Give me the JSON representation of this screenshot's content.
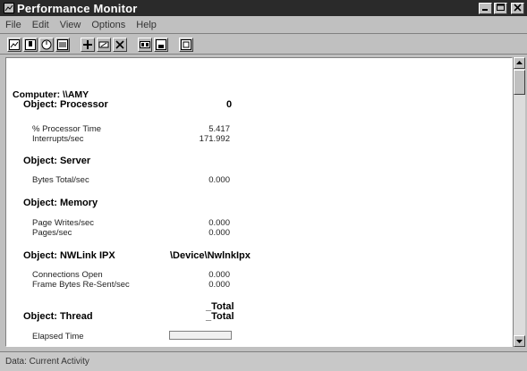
{
  "window": {
    "title": "Performance Monitor"
  },
  "menu": [
    "File",
    "Edit",
    "View",
    "Options",
    "Help"
  ],
  "toolbar": [
    "chart-view-icon",
    "alert-view-icon",
    "log-view-icon",
    "report-view-icon",
    "add-counter-icon",
    "edit-counter-icon",
    "delete-counter-icon",
    "update-now-icon",
    "bookmark-icon",
    "options-icon"
  ],
  "report": {
    "computer": "Computer: \\\\AMY",
    "processor": {
      "object": "Object: Processor",
      "instance": "0",
      "counters": [
        {
          "name": "% Processor Time",
          "value": "5.417"
        },
        {
          "name": "Interrupts/sec",
          "value": "171.992"
        }
      ]
    },
    "server": {
      "object": "Object: Server",
      "counters": [
        {
          "name": "Bytes Total/sec",
          "value": "0.000"
        }
      ]
    },
    "memory": {
      "object": "Object: Memory",
      "counters": [
        {
          "name": "Page Writes/sec",
          "value": "0.000"
        },
        {
          "name": "Pages/sec",
          "value": "0.000"
        }
      ]
    },
    "ipx": {
      "object": "Object: NWLink IPX",
      "instance": "\\Device\\NwlnkIpx",
      "counters": [
        {
          "name": "Connections Open",
          "value": "0.000"
        },
        {
          "name": "Frame Bytes Re-Sent/sec",
          "value": "0.000"
        }
      ]
    },
    "thread": {
      "object": "Object: Thread",
      "instance_top": "_Total",
      "instance": "_Total",
      "counters": [
        {
          "name": "Elapsed Time",
          "value": ""
        }
      ]
    }
  },
  "status": "Data: Current Activity"
}
